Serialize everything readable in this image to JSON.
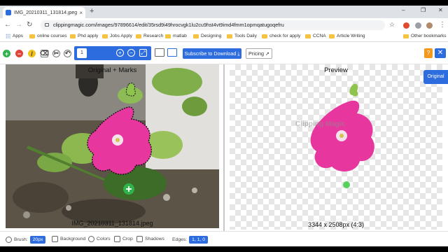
{
  "browser": {
    "tab_title": "IMG_20210311_131814.jpeg - Cl",
    "new_tab_symbol": "+",
    "url": "clippingmagic.com/images/97896614/edit/35rsd9i49hrocvgk1lu2cu9hst4vt9imd4fmm1opmqatugoqefru",
    "window_controls": [
      "–",
      "❐",
      "✕"
    ]
  },
  "bookmarks": {
    "apps_label": "Apps",
    "items": [
      "online courses",
      "Phd apply",
      "Jobs Apply",
      "Research",
      "matlab",
      "Designing",
      "Tools Daily",
      "check for apply",
      "CCNA",
      "Article Writing"
    ],
    "other_label": "Other bookmarks"
  },
  "toolbar": {
    "zoom_value": "1",
    "subscribe_label": "Subscribe to Download ⤓",
    "pricing_label": "Pricing ↗",
    "help_label": "?",
    "close_label": "✕"
  },
  "left_pane": {
    "title": "Original + Marks",
    "filename": "IMG_20210311_131814.jpeg"
  },
  "right_pane": {
    "title": "Preview",
    "watermark": "Clipping Magic",
    "dimensions": "3344 x 2508px (4:3)",
    "side_tab": "Original"
  },
  "bottom_bar": {
    "brush_label": "Brush:",
    "brush_value": "20px",
    "background_label": "Background",
    "colors_label": "Colors",
    "crop_label": "Crop",
    "shadows_label": "Shadows",
    "edges_label": "Edges:",
    "edges_value": "1, 1, 0"
  },
  "colors": {
    "accent": "#2d6cdf",
    "keep_mark": "#2fb34a",
    "remove_mark": "#e0453a",
    "flower": "#e8369f"
  }
}
